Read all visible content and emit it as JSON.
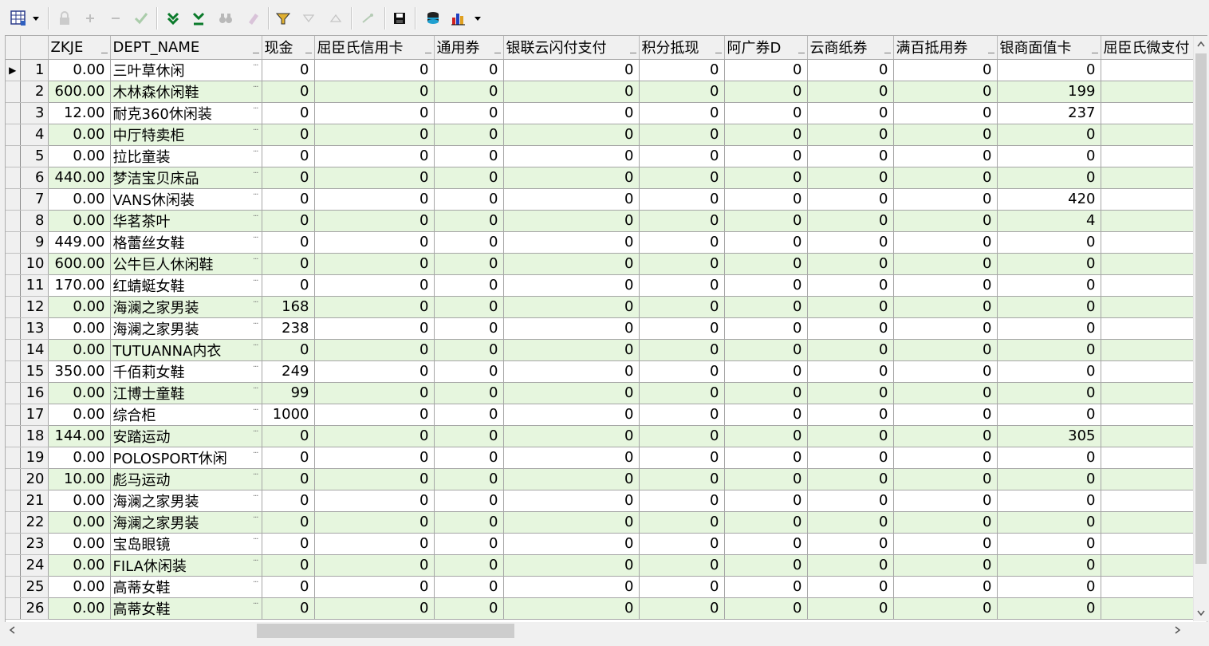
{
  "toolbar": {
    "icons": [
      "grid-view-icon",
      "dropdown-arrow-icon",
      "lock-icon",
      "plus-icon",
      "minus-icon",
      "check-icon",
      "arrow-down-double-green-icon",
      "arrow-down-skip-green-icon",
      "binoculars-icon",
      "eraser-icon",
      "filter-icon",
      "triangle-down-icon",
      "triangle-up-icon",
      "sort-icon",
      "save-icon",
      "database-icon",
      "chart-icon",
      "chart-dropdown-icon"
    ]
  },
  "columns": [
    "ZKJE",
    "DEPT_NAME",
    "现金",
    "屈臣氏信用卡",
    "通用券",
    "银联云闪付支付",
    "积分抵现",
    "阿广券D",
    "云商纸券",
    "满百抵用券",
    "银商面值卡",
    "屈臣氏微支付"
  ],
  "rows": [
    {
      "n": "1",
      "zkje": "0.00",
      "dept": "三叶草休闲",
      "v": [
        "0",
        "0",
        "0",
        "0",
        "0",
        "0",
        "0",
        "0",
        "0"
      ]
    },
    {
      "n": "2",
      "zkje": "600.00",
      "dept": "木林森休闲鞋",
      "v": [
        "0",
        "0",
        "0",
        "0",
        "0",
        "0",
        "0",
        "0",
        "199"
      ]
    },
    {
      "n": "3",
      "zkje": "12.00",
      "dept": "耐克360休闲装",
      "v": [
        "0",
        "0",
        "0",
        "0",
        "0",
        "0",
        "0",
        "0",
        "237"
      ]
    },
    {
      "n": "4",
      "zkje": "0.00",
      "dept": "中厅特卖柜",
      "v": [
        "0",
        "0",
        "0",
        "0",
        "0",
        "0",
        "0",
        "0",
        "0"
      ]
    },
    {
      "n": "5",
      "zkje": "0.00",
      "dept": "拉比童装",
      "v": [
        "0",
        "0",
        "0",
        "0",
        "0",
        "0",
        "0",
        "0",
        "0"
      ]
    },
    {
      "n": "6",
      "zkje": "440.00",
      "dept": "梦洁宝贝床品",
      "v": [
        "0",
        "0",
        "0",
        "0",
        "0",
        "0",
        "0",
        "0",
        "0"
      ]
    },
    {
      "n": "7",
      "zkje": "0.00",
      "dept": "VANS休闲装",
      "v": [
        "0",
        "0",
        "0",
        "0",
        "0",
        "0",
        "0",
        "0",
        "420"
      ]
    },
    {
      "n": "8",
      "zkje": "0.00",
      "dept": "华茗茶叶",
      "v": [
        "0",
        "0",
        "0",
        "0",
        "0",
        "0",
        "0",
        "0",
        "4"
      ]
    },
    {
      "n": "9",
      "zkje": "449.00",
      "dept": "格蕾丝女鞋",
      "v": [
        "0",
        "0",
        "0",
        "0",
        "0",
        "0",
        "0",
        "0",
        "0"
      ]
    },
    {
      "n": "10",
      "zkje": "600.00",
      "dept": "公牛巨人休闲鞋",
      "v": [
        "0",
        "0",
        "0",
        "0",
        "0",
        "0",
        "0",
        "0",
        "0"
      ]
    },
    {
      "n": "11",
      "zkje": "170.00",
      "dept": "红蜻蜓女鞋",
      "v": [
        "0",
        "0",
        "0",
        "0",
        "0",
        "0",
        "0",
        "0",
        "0"
      ]
    },
    {
      "n": "12",
      "zkje": "0.00",
      "dept": "海澜之家男装",
      "v": [
        "168",
        "0",
        "0",
        "0",
        "0",
        "0",
        "0",
        "0",
        "0"
      ]
    },
    {
      "n": "13",
      "zkje": "0.00",
      "dept": "海澜之家男装",
      "v": [
        "238",
        "0",
        "0",
        "0",
        "0",
        "0",
        "0",
        "0",
        "0"
      ]
    },
    {
      "n": "14",
      "zkje": "0.00",
      "dept": "TUTUANNA内衣",
      "v": [
        "0",
        "0",
        "0",
        "0",
        "0",
        "0",
        "0",
        "0",
        "0"
      ]
    },
    {
      "n": "15",
      "zkje": "350.00",
      "dept": "千佰莉女鞋",
      "v": [
        "249",
        "0",
        "0",
        "0",
        "0",
        "0",
        "0",
        "0",
        "0"
      ]
    },
    {
      "n": "16",
      "zkje": "0.00",
      "dept": "江博士童鞋",
      "v": [
        "99",
        "0",
        "0",
        "0",
        "0",
        "0",
        "0",
        "0",
        "0"
      ]
    },
    {
      "n": "17",
      "zkje": "0.00",
      "dept": "综合柜",
      "v": [
        "1000",
        "0",
        "0",
        "0",
        "0",
        "0",
        "0",
        "0",
        "0"
      ]
    },
    {
      "n": "18",
      "zkje": "144.00",
      "dept": "安踏运动",
      "v": [
        "0",
        "0",
        "0",
        "0",
        "0",
        "0",
        "0",
        "0",
        "305"
      ]
    },
    {
      "n": "19",
      "zkje": "0.00",
      "dept": "POLOSPORT休闲",
      "v": [
        "0",
        "0",
        "0",
        "0",
        "0",
        "0",
        "0",
        "0",
        "0"
      ]
    },
    {
      "n": "20",
      "zkje": "10.00",
      "dept": "彪马运动",
      "v": [
        "0",
        "0",
        "0",
        "0",
        "0",
        "0",
        "0",
        "0",
        "0"
      ]
    },
    {
      "n": "21",
      "zkje": "0.00",
      "dept": "海澜之家男装",
      "v": [
        "0",
        "0",
        "0",
        "0",
        "0",
        "0",
        "0",
        "0",
        "0"
      ]
    },
    {
      "n": "22",
      "zkje": "0.00",
      "dept": "海澜之家男装",
      "v": [
        "0",
        "0",
        "0",
        "0",
        "0",
        "0",
        "0",
        "0",
        "0"
      ]
    },
    {
      "n": "23",
      "zkje": "0.00",
      "dept": "宝岛眼镜",
      "v": [
        "0",
        "0",
        "0",
        "0",
        "0",
        "0",
        "0",
        "0",
        "0"
      ]
    },
    {
      "n": "24",
      "zkje": "0.00",
      "dept": "FILA休闲装",
      "v": [
        "0",
        "0",
        "0",
        "0",
        "0",
        "0",
        "0",
        "0",
        "0"
      ]
    },
    {
      "n": "25",
      "zkje": "0.00",
      "dept": "高蒂女鞋",
      "v": [
        "0",
        "0",
        "0",
        "0",
        "0",
        "0",
        "0",
        "0",
        "0"
      ]
    },
    {
      "n": "26",
      "zkje": "0.00",
      "dept": "高蒂女鞋",
      "v": [
        "0",
        "0",
        "0",
        "0",
        "0",
        "0",
        "0",
        "0",
        "0"
      ]
    }
  ],
  "current_row_marker": "▶",
  "colors": {
    "alt_row": "#e6f6de",
    "header": "#f0f0f0"
  }
}
